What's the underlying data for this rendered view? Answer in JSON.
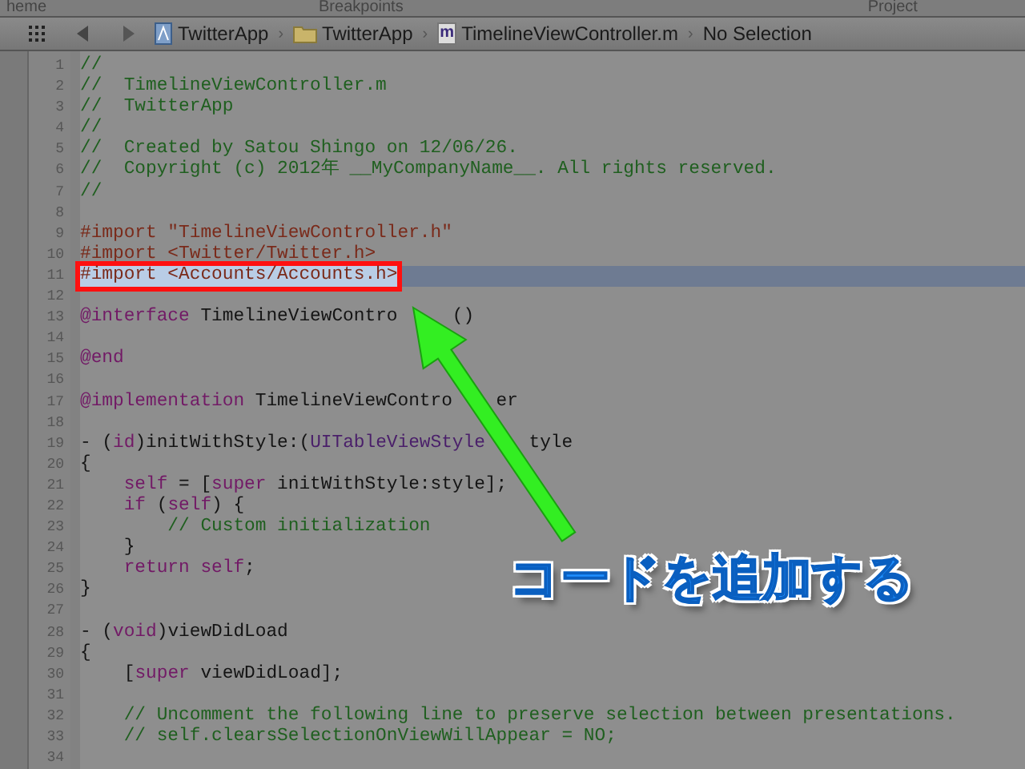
{
  "top_strip": {
    "tabs": [
      "heme",
      "Breakpoints",
      "Project"
    ]
  },
  "jump_bar": {
    "separator": "›",
    "crumbs": [
      {
        "label": "TwitterApp",
        "kind": "project"
      },
      {
        "label": "TwitterApp",
        "kind": "folder"
      },
      {
        "label": "TimelineViewController.m",
        "kind": "file",
        "badge": "m"
      },
      {
        "label": "No Selection",
        "kind": "plain"
      }
    ]
  },
  "editor": {
    "lines": [
      {
        "num": "1",
        "tokens": [
          {
            "text": "//",
            "kind": "comment"
          }
        ]
      },
      {
        "num": "2",
        "tokens": [
          {
            "text": "//  TimelineViewController.m",
            "kind": "comment"
          }
        ]
      },
      {
        "num": "3",
        "tokens": [
          {
            "text": "//  TwitterApp",
            "kind": "comment"
          }
        ]
      },
      {
        "num": "4",
        "tokens": [
          {
            "text": "//",
            "kind": "comment"
          }
        ]
      },
      {
        "num": "5",
        "tokens": [
          {
            "text": "//  Created by Satou Shingo on 12/06/26.",
            "kind": "comment"
          }
        ]
      },
      {
        "num": "6",
        "tokens": [
          {
            "text": "//  Copyright (c) 2012年 __MyCompanyName__. All rights reserved.",
            "kind": "comment"
          }
        ]
      },
      {
        "num": "7",
        "tokens": [
          {
            "text": "//",
            "kind": "comment"
          }
        ]
      },
      {
        "num": "8"
      },
      {
        "num": "9",
        "tokens": [
          {
            "text": "#import \"TimelineViewController.h\"",
            "kind": "directive"
          }
        ]
      },
      {
        "num": "10",
        "tokens": [
          {
            "text": "#import <Twitter/Twitter.h>",
            "kind": "directive"
          }
        ]
      },
      {
        "num": "11",
        "selected": true,
        "tokens": [
          {
            "text": "#import <Accounts/Accounts.h>",
            "kind": "directive"
          }
        ]
      },
      {
        "num": "12"
      },
      {
        "num": "13",
        "tokens": [
          {
            "text": "@interface",
            "kind": "keyword"
          },
          {
            "text": " TimelineViewContro",
            "kind": "plain"
          },
          {
            "text": " ()",
            "kind": "plain",
            "covered_before": true
          }
        ]
      },
      {
        "num": "14"
      },
      {
        "num": "15",
        "tokens": [
          {
            "text": "@end",
            "kind": "keyword"
          }
        ]
      },
      {
        "num": "16"
      },
      {
        "num": "17",
        "tokens": [
          {
            "text": "@implementation",
            "kind": "keyword"
          },
          {
            "text": " TimelineViewContro",
            "kind": "plain"
          },
          {
            "text": "er",
            "kind": "plain",
            "covered_before": true
          }
        ]
      },
      {
        "num": "18"
      },
      {
        "num": "19",
        "tokens": [
          {
            "text": "- (",
            "kind": "plain"
          },
          {
            "text": "id",
            "kind": "keyword"
          },
          {
            "text": ")initWithStyle:(",
            "kind": "plain"
          },
          {
            "text": "UITableViewStyle",
            "kind": "type"
          },
          {
            "text": "tyle",
            "kind": "plain",
            "covered_before": true
          }
        ]
      },
      {
        "num": "20",
        "tokens": [
          {
            "text": "{",
            "kind": "plain"
          }
        ]
      },
      {
        "num": "21",
        "tokens": [
          {
            "text": "    self",
            "kind": "keyword"
          },
          {
            "text": " = [",
            "kind": "plain"
          },
          {
            "text": "super",
            "kind": "keyword"
          },
          {
            "text": " initWithStyle:style];",
            "kind": "plain"
          }
        ]
      },
      {
        "num": "22",
        "tokens": [
          {
            "text": "    if",
            "kind": "keyword"
          },
          {
            "text": " (",
            "kind": "plain"
          },
          {
            "text": "self",
            "kind": "keyword"
          },
          {
            "text": ") {",
            "kind": "plain"
          }
        ]
      },
      {
        "num": "23",
        "tokens": [
          {
            "text": "        // Custom initialization",
            "kind": "comment"
          }
        ]
      },
      {
        "num": "24",
        "tokens": [
          {
            "text": "    }",
            "kind": "plain"
          }
        ]
      },
      {
        "num": "25",
        "tokens": [
          {
            "text": "    return self",
            "kind": "keyword"
          },
          {
            "text": ";",
            "kind": "plain"
          }
        ]
      },
      {
        "num": "26",
        "tokens": [
          {
            "text": "}",
            "kind": "plain"
          }
        ]
      },
      {
        "num": "27"
      },
      {
        "num": "28",
        "tokens": [
          {
            "text": "- (",
            "kind": "plain"
          },
          {
            "text": "void",
            "kind": "keyword"
          },
          {
            "text": ")viewDidLoad",
            "kind": "plain"
          }
        ]
      },
      {
        "num": "29",
        "tokens": [
          {
            "text": "{",
            "kind": "plain"
          }
        ]
      },
      {
        "num": "30",
        "tokens": [
          {
            "text": "    [",
            "kind": "plain"
          },
          {
            "text": "super",
            "kind": "keyword"
          },
          {
            "text": " viewDidLoad];",
            "kind": "plain"
          }
        ]
      },
      {
        "num": "31"
      },
      {
        "num": "32",
        "tokens": [
          {
            "text": "    // Uncomment the following line to preserve selection between presentations.",
            "kind": "comment"
          }
        ]
      },
      {
        "num": "33",
        "tokens": [
          {
            "text": "    // self.clearsSelectionOnViewWillAppear = NO;",
            "kind": "comment"
          }
        ]
      },
      {
        "num": "34"
      }
    ]
  },
  "callout": {
    "text": "コードを追加する"
  }
}
